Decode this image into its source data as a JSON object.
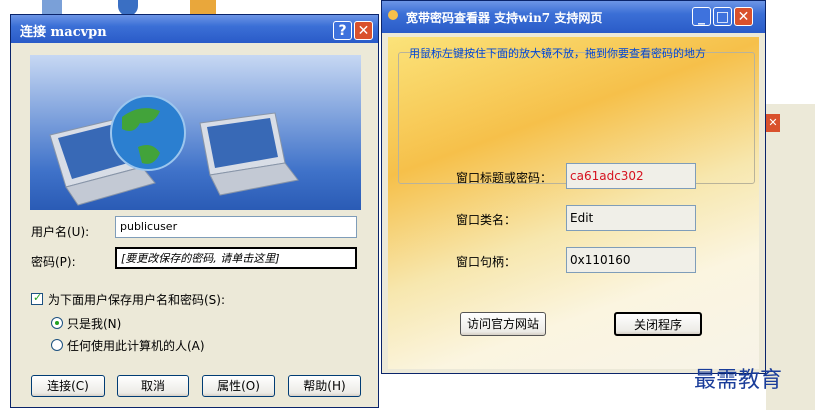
{
  "connect_dialog": {
    "title": "连接 macvpn",
    "username_label": "用户名(U):",
    "username_value": "publicuser",
    "password_label": "密码(P):",
    "password_value": "[要更改保存的密码, 请单击这里]",
    "save_checkbox_label": "为下面用户保存用户名和密码(S):",
    "save_checked": true,
    "radio_me_label": "只是我(N)",
    "radio_me_selected": true,
    "radio_anyone_label": "任何使用此计算机的人(A)",
    "buttons": {
      "connect": "连接(C)",
      "cancel": "取消",
      "properties": "属性(O)",
      "help": "帮助(H)"
    }
  },
  "viewer_dialog": {
    "title": "宽带密码查看器 支持win7 支持网页",
    "hint": "用鼠标左键按住下面的放大镜不放，拖到你要查看密码的地方",
    "title_or_password_label": "窗口标题或密码：",
    "title_or_password_value": "ca61adc302",
    "class_label": "窗口类名：",
    "class_value": "Edit",
    "handle_label": "窗口句柄：",
    "handle_value": "0x110160",
    "buttons": {
      "visit": "访问官方网站",
      "close": "关闭程序"
    }
  },
  "watermark": "最需教育",
  "colors": {
    "titlebar": "#2a5bc8",
    "password_value": "#d6121f",
    "hint_text": "#0046d5"
  }
}
